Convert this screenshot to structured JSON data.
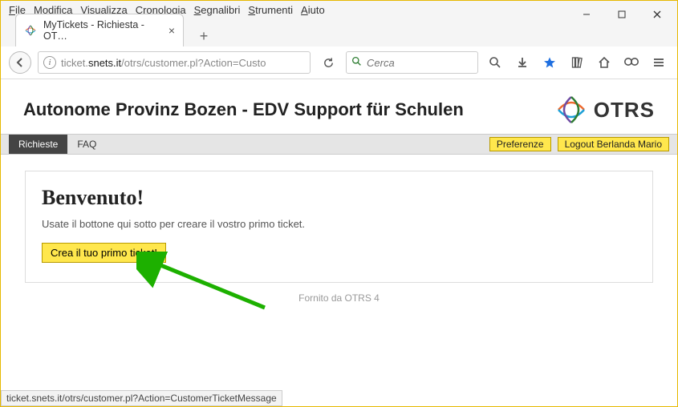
{
  "menu": {
    "items": [
      "File",
      "Modifica",
      "Visualizza",
      "Cronologia",
      "Segnalibri",
      "Strumenti",
      "Aiuto"
    ]
  },
  "tab": {
    "title": "MyTickets - Richiesta - OT…"
  },
  "address": {
    "prefix": "ticket.",
    "host": "snets.it",
    "path": "/otrs/customer.pl?Action=Custo"
  },
  "search": {
    "placeholder": "Cerca"
  },
  "header": {
    "title": "Autonome Provinz Bozen - EDV Support für Schulen",
    "brand": "OTRS"
  },
  "nav": {
    "items": [
      {
        "label": "Richieste",
        "active": true
      },
      {
        "label": "FAQ",
        "active": false
      }
    ],
    "right": [
      {
        "label": "Preferenze"
      },
      {
        "label": "Logout Berlanda Mario"
      }
    ]
  },
  "content": {
    "heading": "Benvenuto!",
    "intro": "Usate il bottone qui sotto per creare il vostro primo ticket.",
    "button_label": "Crea il tuo primo ticket!",
    "footer": "Fornito da OTRS 4"
  },
  "status_bar": "ticket.snets.it/otrs/customer.pl?Action=CustomerTicketMessage"
}
